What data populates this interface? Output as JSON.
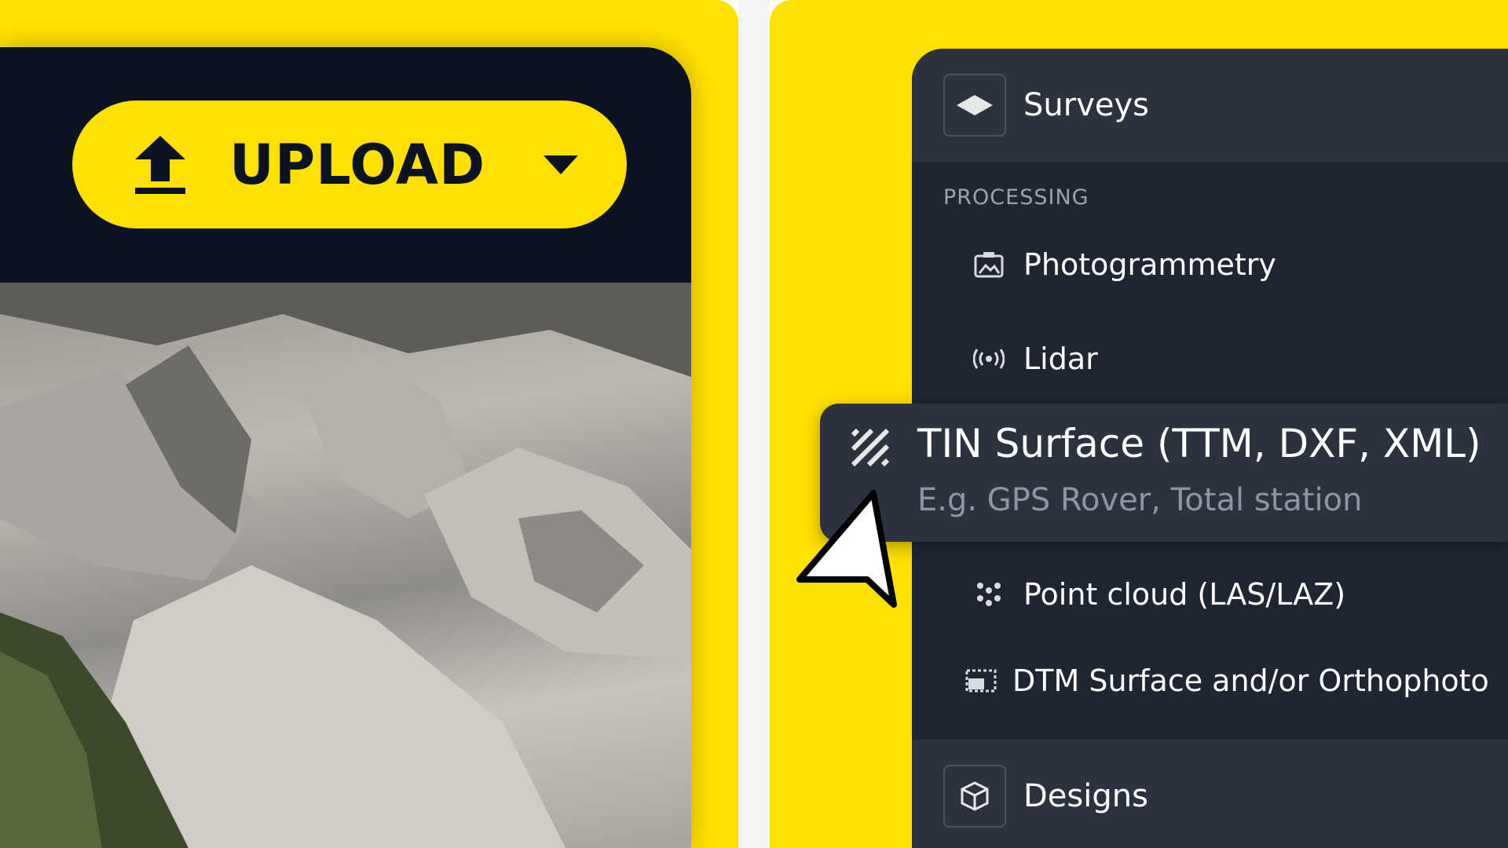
{
  "upload": {
    "label": "UPLOAD",
    "icon": "upload-icon",
    "dropdown_icon": "caret-down-icon"
  },
  "menu": {
    "surveys_label": "Surveys",
    "processing_label": "PROCESSING",
    "items": [
      {
        "label": "Photogrammetry",
        "icon": "photo-icon"
      },
      {
        "label": "Lidar",
        "icon": "lidar-icon"
      },
      {
        "label": "Point cloud (LAS/LAZ)",
        "icon": "point-cloud-icon"
      },
      {
        "label": "DTM Surface and/or Orthophoto",
        "icon": "dtm-icon"
      }
    ],
    "highlighted": {
      "title": "TIN Surface (TTM, DXF, XML)",
      "subtitle": "E.g. GPS Rover, Total station",
      "icon": "hatch-icon"
    },
    "designs_label": "Designs"
  },
  "colors": {
    "brand_yellow": "#FFE000",
    "dark_bg": "#0B1220",
    "panel_bg": "#1F2631",
    "header_bg": "#2C333F"
  }
}
